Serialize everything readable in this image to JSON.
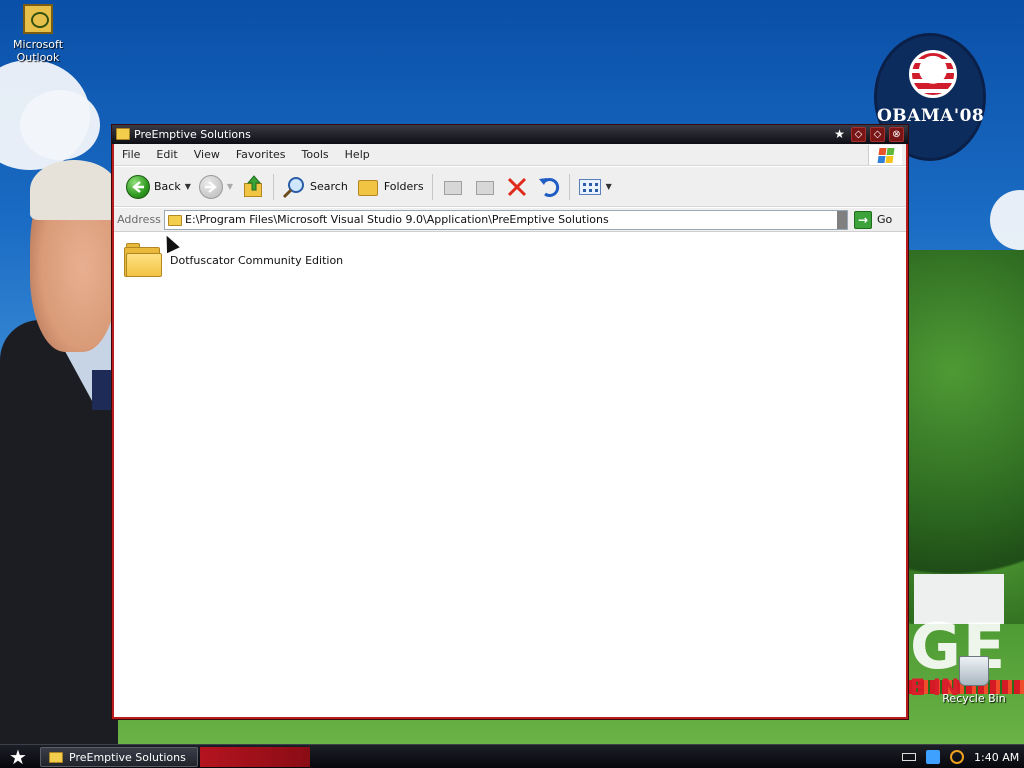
{
  "desktop": {
    "icons": [
      {
        "label": "Microsoft Outlook"
      },
      {
        "label": "Recycle Bin"
      }
    ],
    "wallpaper": {
      "logo_text": "OBAMA'08",
      "big_text": "GE",
      "sub_text": "E IN"
    }
  },
  "window": {
    "title": "PreEmptive Solutions",
    "menu": [
      "File",
      "Edit",
      "View",
      "Favorites",
      "Tools",
      "Help"
    ],
    "toolbar": {
      "back_label": "Back",
      "search_label": "Search",
      "folders_label": "Folders"
    },
    "address": {
      "label": "Address",
      "value": "E:\\Program Files\\Microsoft Visual Studio 9.0\\Application\\PreEmptive Solutions",
      "go_label": "Go"
    },
    "items": [
      {
        "name": "Dotfuscator Community Edition",
        "type": "folder"
      }
    ]
  },
  "taskbar": {
    "task_label": "PreEmptive Solutions",
    "clock": "1:40 AM"
  },
  "colors": {
    "title_bar": "#0d0d14",
    "window_border": "#b81c1c",
    "toolbar_bg": "#efefef",
    "taskbar": "#07080c"
  }
}
